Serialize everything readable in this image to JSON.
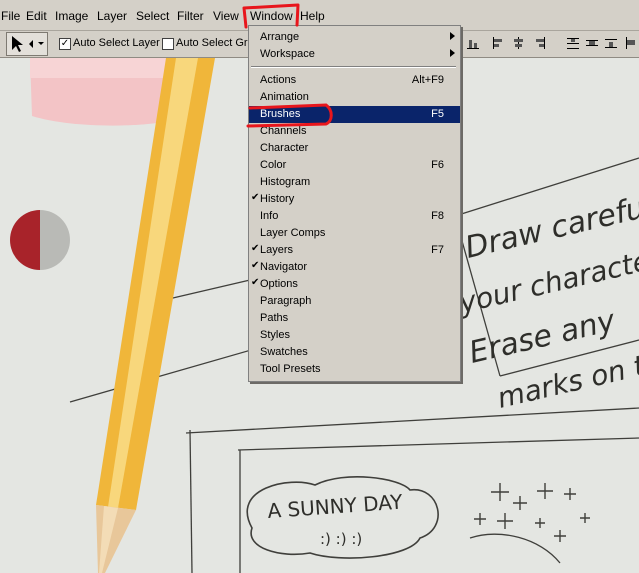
{
  "menubar": {
    "items": [
      "File",
      "Edit",
      "Image",
      "Layer",
      "Select",
      "Filter",
      "View",
      "Window",
      "Help"
    ]
  },
  "options_bar": {
    "auto_select_layer_label": "Auto Select Layer",
    "auto_select_groups_label": "Auto Select Gro",
    "auto_select_layer_checked": true,
    "auto_select_groups_checked": false
  },
  "window_menu": {
    "items": [
      {
        "label": "Arrange",
        "shortcut": "",
        "submenu": true,
        "checked": false,
        "highlighted": false
      },
      {
        "label": "Workspace",
        "shortcut": "",
        "submenu": true,
        "checked": false,
        "highlighted": false
      },
      {
        "label": "Actions",
        "shortcut": "Alt+F9",
        "submenu": false,
        "checked": false,
        "highlighted": false
      },
      {
        "label": "Animation",
        "shortcut": "",
        "submenu": false,
        "checked": false,
        "highlighted": false
      },
      {
        "label": "Brushes",
        "shortcut": "F5",
        "submenu": false,
        "checked": false,
        "highlighted": true
      },
      {
        "label": "Channels",
        "shortcut": "",
        "submenu": false,
        "checked": false,
        "highlighted": false
      },
      {
        "label": "Character",
        "shortcut": "",
        "submenu": false,
        "checked": false,
        "highlighted": false
      },
      {
        "label": "Color",
        "shortcut": "F6",
        "submenu": false,
        "checked": false,
        "highlighted": false
      },
      {
        "label": "Histogram",
        "shortcut": "",
        "submenu": false,
        "checked": false,
        "highlighted": false
      },
      {
        "label": "History",
        "shortcut": "",
        "submenu": false,
        "checked": true,
        "highlighted": false
      },
      {
        "label": "Info",
        "shortcut": "F8",
        "submenu": false,
        "checked": false,
        "highlighted": false
      },
      {
        "label": "Layer Comps",
        "shortcut": "",
        "submenu": false,
        "checked": false,
        "highlighted": false
      },
      {
        "label": "Layers",
        "shortcut": "F7",
        "submenu": false,
        "checked": true,
        "highlighted": false
      },
      {
        "label": "Navigator",
        "shortcut": "",
        "submenu": false,
        "checked": true,
        "highlighted": false
      },
      {
        "label": "Options",
        "shortcut": "",
        "submenu": false,
        "checked": true,
        "highlighted": false
      },
      {
        "label": "Paragraph",
        "shortcut": "",
        "submenu": false,
        "checked": false,
        "highlighted": false
      },
      {
        "label": "Paths",
        "shortcut": "",
        "submenu": false,
        "checked": false,
        "highlighted": false
      },
      {
        "label": "Styles",
        "shortcut": "",
        "submenu": false,
        "checked": false,
        "highlighted": false
      },
      {
        "label": "Swatches",
        "shortcut": "",
        "submenu": false,
        "checked": false,
        "highlighted": false
      },
      {
        "label": "Tool Presets",
        "shortcut": "",
        "submenu": false,
        "checked": false,
        "highlighted": false
      }
    ]
  },
  "canvas": {
    "handwriting": [
      "Draw carefully",
      "your character",
      "Erase any",
      "marks on the"
    ],
    "bubble_title": "A SUNNY DAY",
    "bubble_faces": ":) :) :)"
  },
  "colors": {
    "menu_bg": "#d4d0c8",
    "highlight": "#0a246a",
    "annotation_red": "#e8161c",
    "pencil_yellow": "#f0b63a",
    "eraser_pink": "#f3c4c6",
    "red_circle": "#a8232a",
    "paper": "#e4e6e2"
  }
}
